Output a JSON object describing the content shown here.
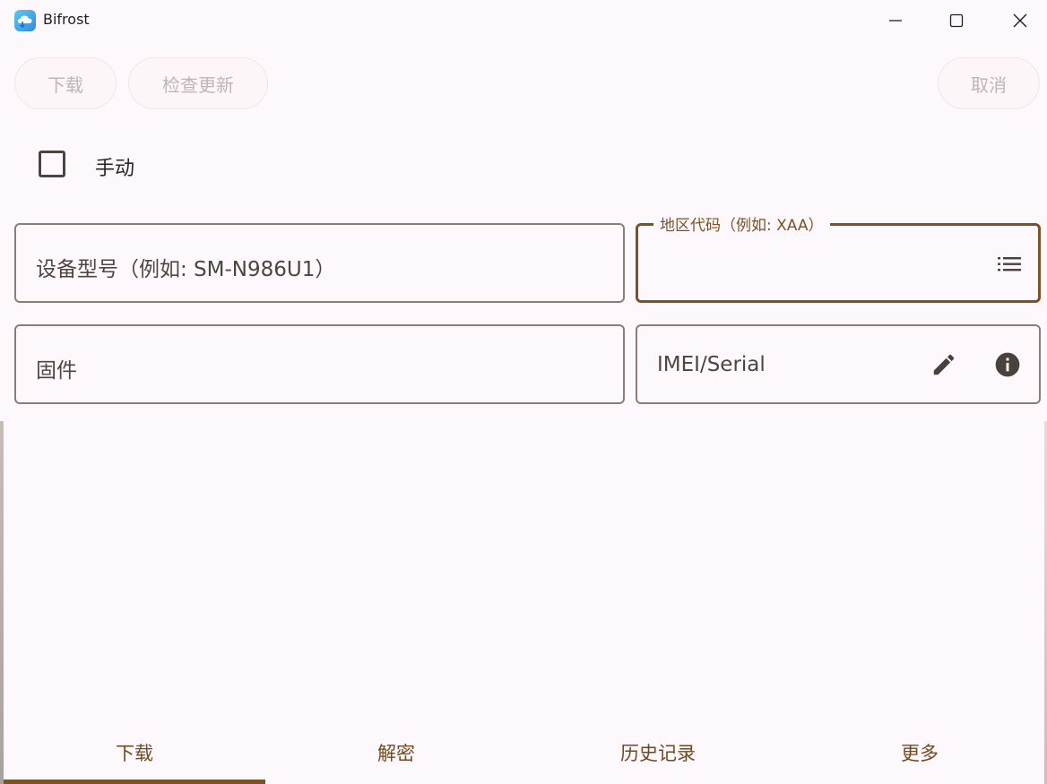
{
  "window": {
    "title": "Bifrost",
    "controls": [
      "minimize-icon",
      "maximize-icon",
      "close-icon"
    ]
  },
  "toolbar": {
    "download_label": "下载",
    "check_update_label": "检查更新",
    "cancel_label": "取消"
  },
  "manual": {
    "label": "手动",
    "checked": false
  },
  "fields": {
    "model_placeholder": "设备型号（例如: SM-N986U1）",
    "region_label": "地区代码（例如: XAA）",
    "region_value": "",
    "firmware_placeholder": "固件",
    "imei_placeholder": "IMEI/Serial",
    "region_icon": "list-icon",
    "imei_icons": [
      "edit-icon",
      "info-icon"
    ]
  },
  "bottom_nav": {
    "tabs": [
      {
        "label": "下载"
      },
      {
        "label": "解密"
      },
      {
        "label": "历史记录"
      },
      {
        "label": "更多"
      }
    ],
    "selected_index": 0
  },
  "colors": {
    "accent": "#7b5226",
    "background": "#fdf8fb",
    "outline": "#8a7e78",
    "disabled_text": "#bdb5b8"
  }
}
